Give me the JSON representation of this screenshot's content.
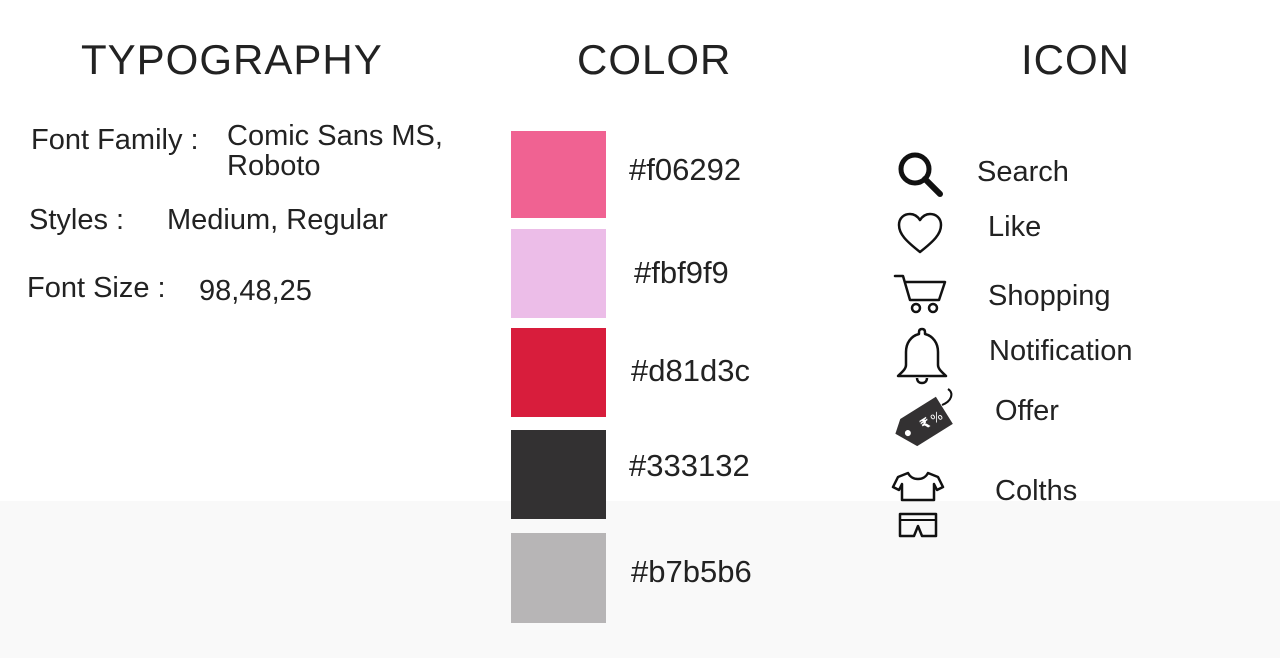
{
  "typography": {
    "heading": "TYPOGRAPHY",
    "font_family_label": "Font Family :",
    "font_family_line1": "Comic Sans MS,",
    "font_family_line2": "Roboto",
    "styles_label": "Styles :",
    "styles_value": "Medium, Regular",
    "font_size_label": "Font Size :",
    "font_size_value": "98,48,25"
  },
  "color": {
    "heading": "COLOR",
    "swatches": [
      {
        "hex": "#f06292"
      },
      {
        "hex": "#fbf9f9",
        "label": "#fbf9f9",
        "display": "#ecbde8"
      },
      {
        "hex": "#d81d3c"
      },
      {
        "hex": "#333132"
      },
      {
        "hex": "#b7b5b6"
      }
    ]
  },
  "icon": {
    "heading": "ICON",
    "items": [
      {
        "icon": "search-icon",
        "label": "Search"
      },
      {
        "icon": "heart-icon",
        "label": "Like"
      },
      {
        "icon": "shopping-cart-icon",
        "label": "Shopping"
      },
      {
        "icon": "bell-icon",
        "label": "Notification"
      },
      {
        "icon": "price-tag-icon",
        "label": "Offer"
      },
      {
        "icon": "clothes-icon",
        "label": "Colths"
      }
    ]
  }
}
